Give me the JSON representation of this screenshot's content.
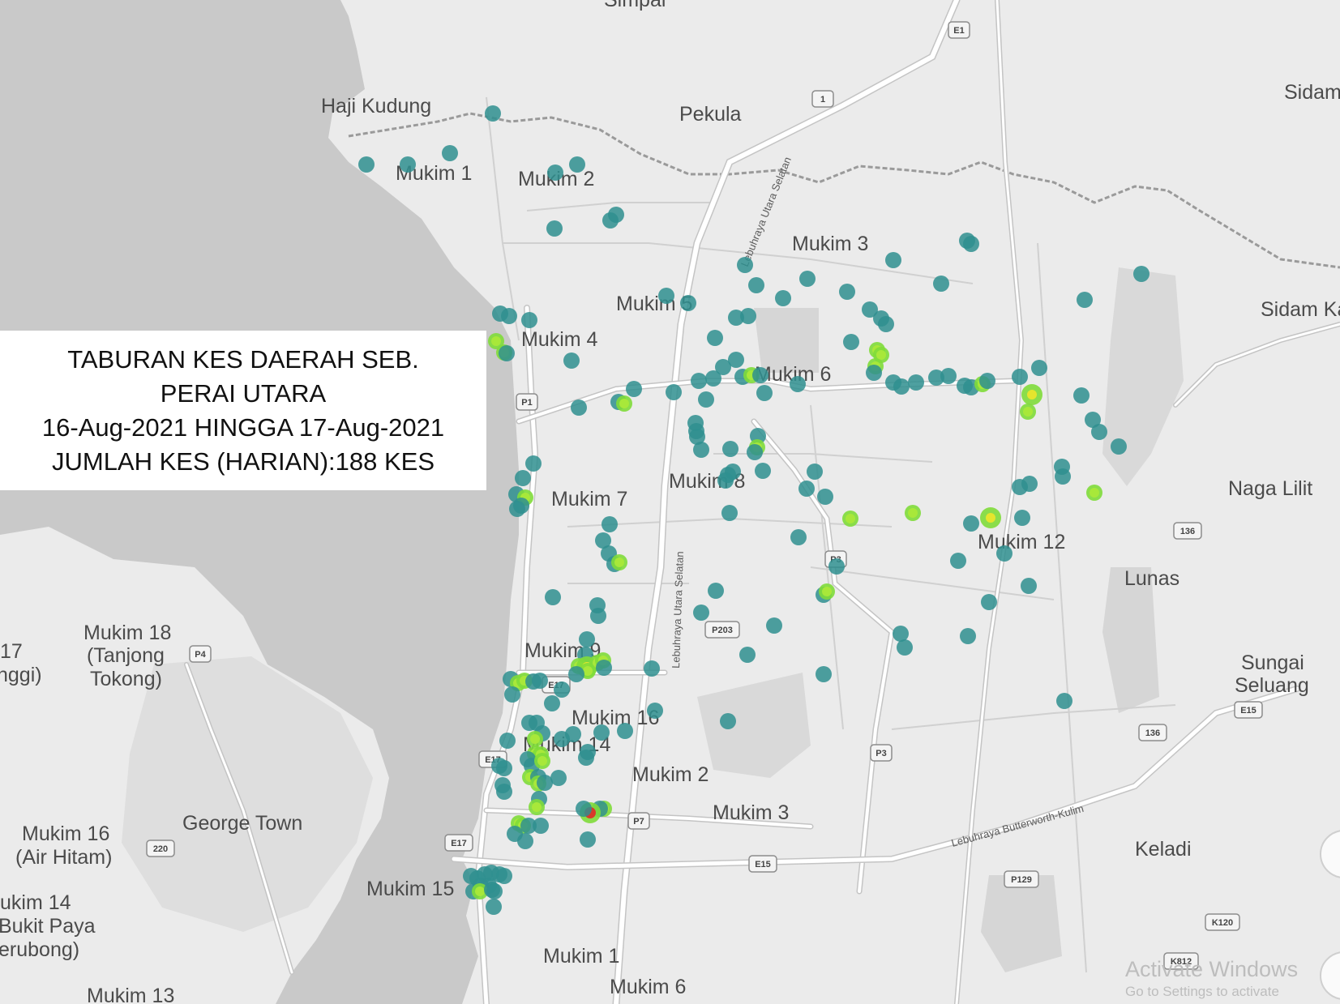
{
  "info": {
    "line1": "TABURAN KES DAERAH SEB.",
    "line2": "PERAI UTARA",
    "line3": "16-Aug-2021 HINGGA 17-Aug-2021",
    "line4": "JUMLAH KES (HARIAN):188 KES"
  },
  "places": {
    "simpai": "Simpai",
    "haji_kudung": "Haji Kudung",
    "pekula": "Pekula",
    "sidam": "Sidam",
    "sidam_kanan": "Sidam Ka",
    "mukim1": "Mukim 1",
    "mukim2": "Mukim 2",
    "mukim3": "Mukim 3",
    "mukim4": "Mukim 4",
    "mukim5": "Mukim 5",
    "mukim6": "Mukim 6",
    "mukim7": "Mukim 7",
    "mukim8": "Mukim 8",
    "mukim9": "Mukim 9",
    "mukim12": "Mukim 12",
    "naga_lilit": "Naga Lilit",
    "lunas": "Lunas",
    "sungai_seluang_1": "Sungai",
    "sungai_seluang_2": "Seluang",
    "keladi": "Keladi",
    "mukim18_1": "Mukim 18",
    "mukim18_2": "(Tanjong",
    "mukim18_3": "Tokong)",
    "mukim17_1": "17",
    "mukim17_2": "nggi)",
    "mukim16_cbd": "Mukim 16",
    "mukim14_cbd": "Mukim 14",
    "mukim2_s": "Mukim 2",
    "mukim3_s": "Mukim 3",
    "george_town": "George Town",
    "mukim16_air_1": "Mukim 16",
    "mukim16_air_2": "(Air Hitam)",
    "mukim14_bp_1": "ukim 14",
    "mukim14_bp_2": "Bukit Paya",
    "mukim14_bp_3": "erubong)",
    "mukim15": "Mukim 15",
    "mukim1_s": "Mukim 1",
    "mukim6_s": "Mukim 6",
    "mukim13": "Mukim 13"
  },
  "roads": {
    "utara_selatan_n": "Lebuhraya Utara Selatan",
    "utara_selatan_s": "Lebuhraya Utara Selatan",
    "butterworth_kulim": "Lebuhraya Butterworth-Kulim"
  },
  "shields": {
    "e1": "E1",
    "r1": "1",
    "p1": "P1",
    "p3a": "P3",
    "p3b": "P3",
    "p4": "P4",
    "p7": "P7",
    "e17a": "E17",
    "e17b": "E17",
    "e17c": "E17",
    "e15a": "E15",
    "e15b": "E15",
    "p203": "P203",
    "r136a": "136",
    "r136b": "136",
    "r220": "220",
    "p129": "P129",
    "k120": "K120",
    "k812": "K812"
  },
  "watermark": {
    "line1": "Activate Windows",
    "line2": "Go to Settings to activate"
  },
  "colors": {
    "land": "#ebebeb",
    "water": "#c9c9c9",
    "road": "#ffffff",
    "road_edge": "#c4c4c4",
    "border": "#9a9a9a",
    "urban": "#cfcfcf",
    "case_low": "#2f8f8f",
    "case_mid": "#7fdc3a",
    "case_high": "#e5e52d",
    "case_peak": "#d93a2a"
  }
}
